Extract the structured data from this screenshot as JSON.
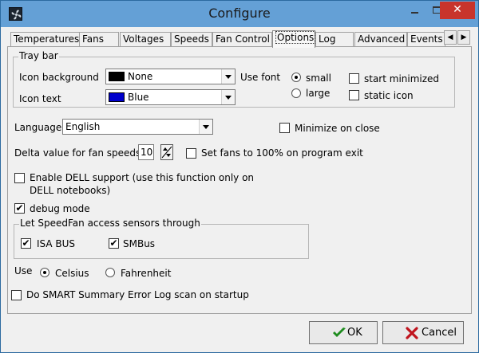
{
  "window": {
    "title": "Configure"
  },
  "tabs": [
    "Temperatures",
    "Fans",
    "Voltages",
    "Speeds",
    "Fan Control",
    "Options",
    "Log",
    "Advanced",
    "Events"
  ],
  "active_tab": "Options",
  "tray_bar": {
    "group_label": "Tray bar",
    "icon_background_label": "Icon background",
    "icon_background_value": "None",
    "icon_background_color": "#000000",
    "icon_text_label": "Icon text",
    "icon_text_value": "Blue",
    "icon_text_color": "#0000cc",
    "use_font_label": "Use font",
    "font_small_label": "small",
    "font_large_label": "large",
    "font_selected": "small",
    "start_minimized_label": "start minimized",
    "static_icon_label": "static icon"
  },
  "language": {
    "label": "Language",
    "value": "English"
  },
  "minimize_on_close_label": "Minimize on close",
  "delta": {
    "label": "Delta value for fan speeds",
    "value": "10"
  },
  "set_fans_label": "Set fans to 100% on program exit",
  "dell": {
    "line1": "Enable DELL support (use this function only on",
    "line2": "DELL notebooks)"
  },
  "debug_mode": {
    "label": "debug mode",
    "checked": true
  },
  "sensors": {
    "group_label": "Let SpeedFan access sensors through",
    "isa_bus_label": "ISA BUS",
    "smbus_label": "SMBus",
    "isa_checked": true,
    "smbus_checked": true
  },
  "units": {
    "use_label": "Use",
    "celsius_label": "Celsius",
    "fahrenheit_label": "Fahrenheit",
    "selected": "Celsius"
  },
  "smart_label": "Do SMART Summary Error Log scan on startup",
  "buttons": {
    "ok_label": "OK",
    "cancel_label": "Cancel"
  },
  "colors": {
    "titlebar": "#64a0d6",
    "close_button": "#c8342c",
    "ok_check": "#1e8c1e",
    "cancel_x": "#c0141e"
  },
  "icons": {
    "app": "speedfan-icon",
    "ok": "checkmark-icon",
    "cancel": "x-icon"
  }
}
